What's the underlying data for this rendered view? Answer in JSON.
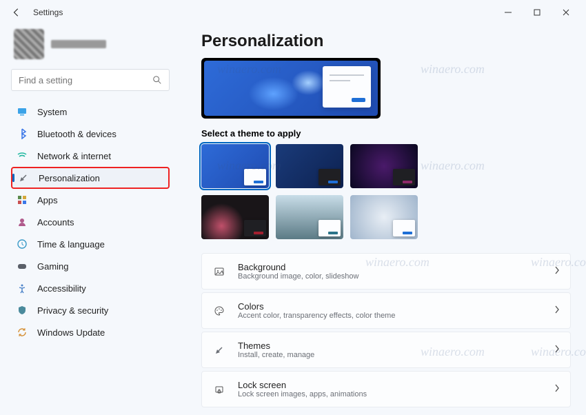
{
  "window": {
    "title": "Settings"
  },
  "search": {
    "placeholder": "Find a setting"
  },
  "sidebar": {
    "items": [
      {
        "label": "System",
        "icon": "system-icon"
      },
      {
        "label": "Bluetooth & devices",
        "icon": "bluetooth-icon"
      },
      {
        "label": "Network & internet",
        "icon": "wifi-icon"
      },
      {
        "label": "Personalization",
        "icon": "brush-icon",
        "active": true,
        "highlighted": true
      },
      {
        "label": "Apps",
        "icon": "apps-icon"
      },
      {
        "label": "Accounts",
        "icon": "accounts-icon"
      },
      {
        "label": "Time & language",
        "icon": "time-icon"
      },
      {
        "label": "Gaming",
        "icon": "gaming-icon"
      },
      {
        "label": "Accessibility",
        "icon": "accessibility-icon"
      },
      {
        "label": "Privacy & security",
        "icon": "privacy-icon"
      },
      {
        "label": "Windows Update",
        "icon": "update-icon"
      }
    ]
  },
  "main": {
    "title": "Personalization",
    "theme_label": "Select a theme to apply",
    "themes": [
      {
        "bg": "tile-bg1",
        "win": "light-win",
        "accent": "#1f6fd6",
        "selected": true
      },
      {
        "bg": "tile-bg2",
        "win": "dark-win",
        "accent": "#1f6fd6"
      },
      {
        "bg": "tile-bg3",
        "win": "dark-win",
        "accent": "#8e2a6a"
      },
      {
        "bg": "tile-bg4",
        "win": "dark-win",
        "accent": "#a31f2f"
      },
      {
        "bg": "tile-bg5",
        "win": "light-win",
        "accent": "#2b7489"
      },
      {
        "bg": "tile-bg6",
        "win": "light-win",
        "accent": "#1f6fd6"
      }
    ],
    "cards": [
      {
        "title": "Background",
        "desc": "Background image, color, slideshow",
        "icon": "image-icon"
      },
      {
        "title": "Colors",
        "desc": "Accent color, transparency effects, color theme",
        "icon": "palette-icon"
      },
      {
        "title": "Themes",
        "desc": "Install, create, manage",
        "icon": "brush-icon",
        "highlighted": true
      },
      {
        "title": "Lock screen",
        "desc": "Lock screen images, apps, animations",
        "icon": "lock-icon"
      }
    ]
  },
  "watermark": "winaero.com"
}
